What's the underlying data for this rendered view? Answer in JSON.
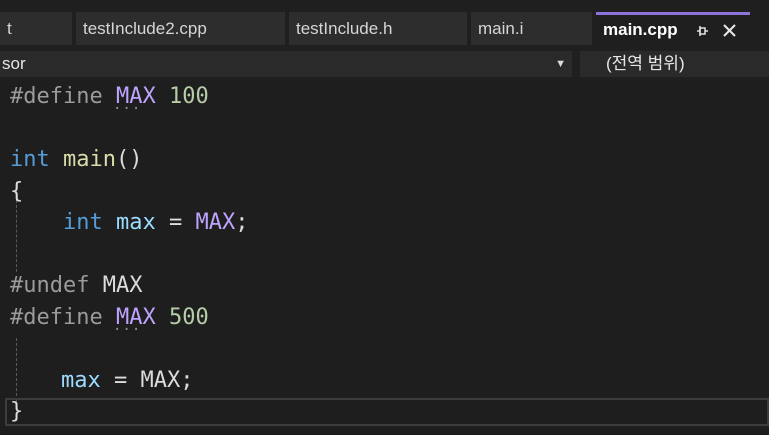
{
  "tabs": [
    {
      "label": "t"
    },
    {
      "label": "testInclude2.cpp"
    },
    {
      "label": "testInclude.h"
    },
    {
      "label": "main.i"
    },
    {
      "label": "main.cpp",
      "pin_icon": "pin-icon",
      "close_icon": "close-icon"
    }
  ],
  "nav": {
    "project_dropdown": "sor",
    "scope_dropdown": "(전역 범위)"
  },
  "code": {
    "l1": {
      "directive": "#define",
      "name": "MAX",
      "value": "100"
    },
    "l3": {
      "type": "int",
      "func": "main",
      "parens": "()"
    },
    "l4": {
      "brace": "{"
    },
    "l5": {
      "type": "int",
      "var": "max",
      "eq": "=",
      "macro": "MAX",
      "semi": ";"
    },
    "l7": {
      "directive": "#undef",
      "name": "MAX"
    },
    "l8": {
      "directive": "#define",
      "name": "MAX",
      "value": "500"
    },
    "l10": {
      "var": "max",
      "eq": "=",
      "macro": "MAX",
      "semi": ";"
    },
    "l11": {
      "brace": "}"
    }
  },
  "colors": {
    "accent": "#8c72d9",
    "keyword": "#569cd6",
    "macro": "#bea3ff",
    "number": "#b5cea8",
    "variable": "#9cdcfe",
    "function": "#dcdcaa"
  }
}
